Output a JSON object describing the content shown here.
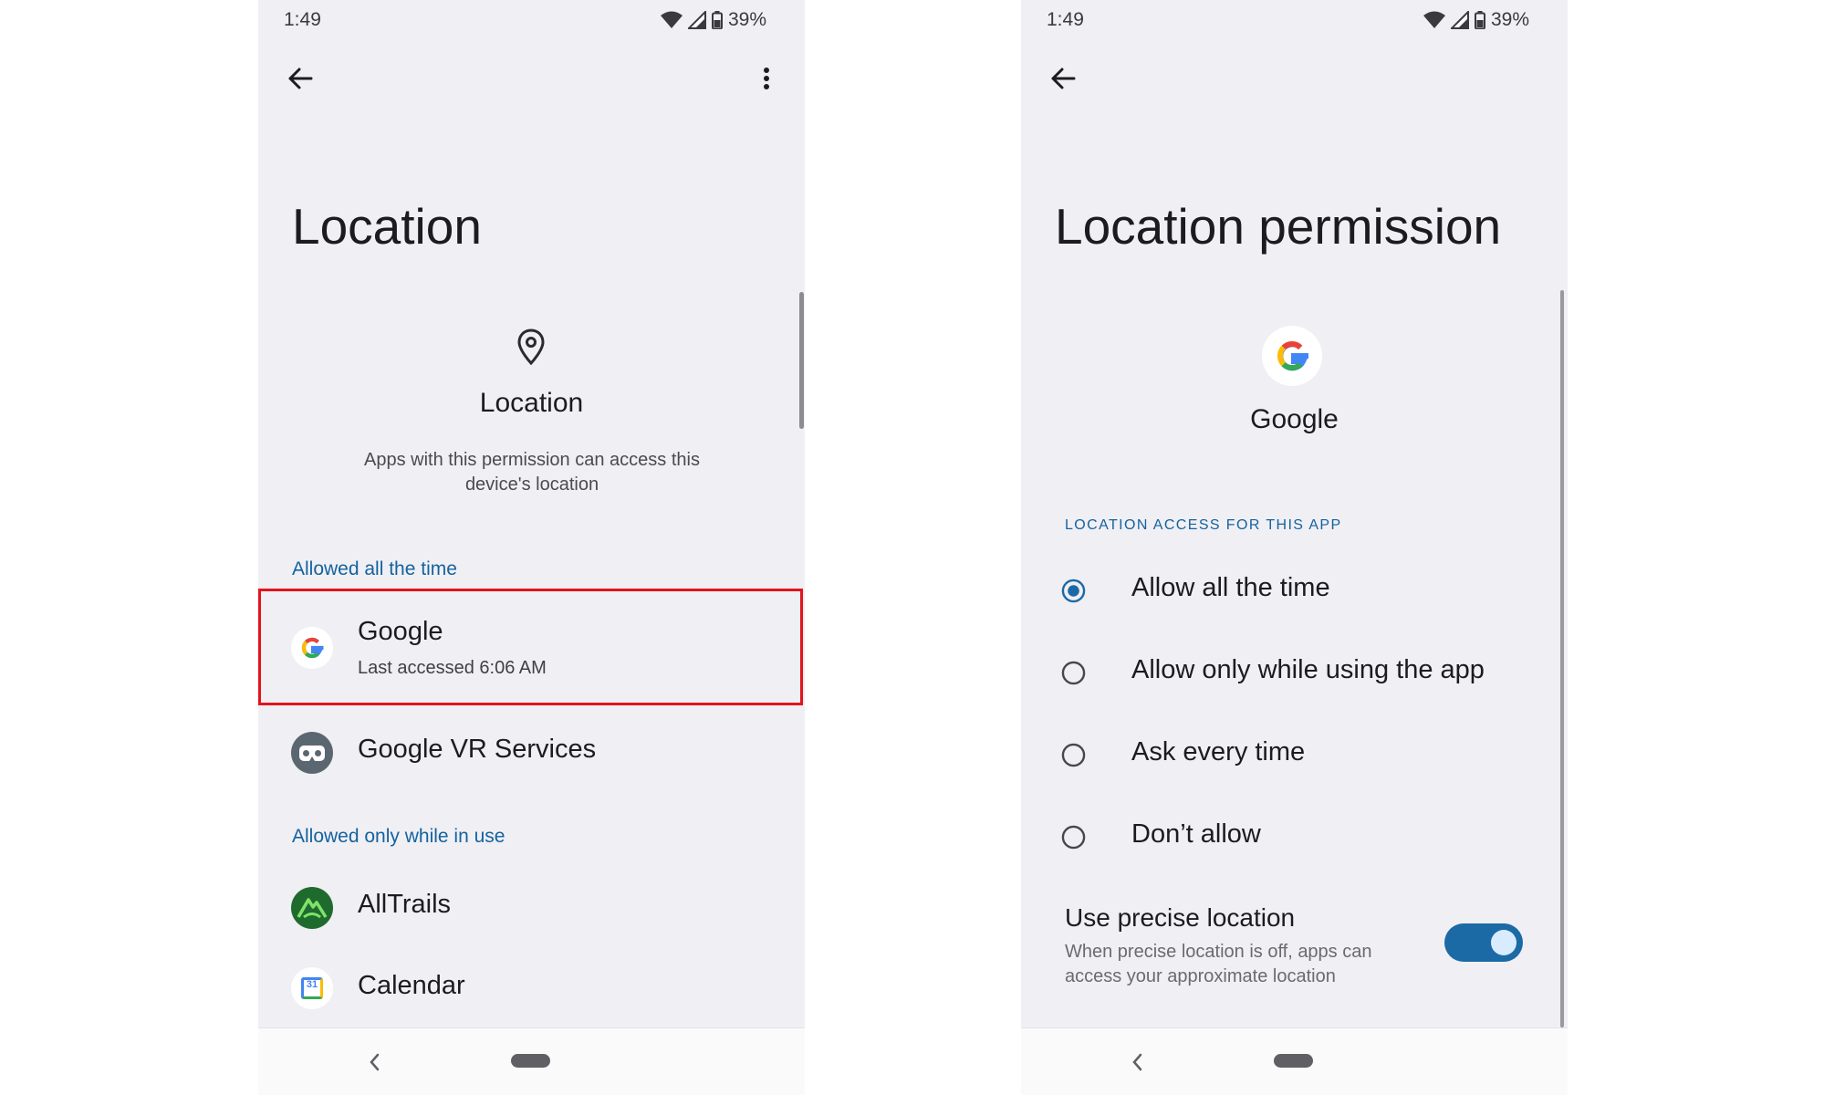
{
  "left": {
    "status": {
      "time": "1:49",
      "battery": "39%"
    },
    "title": "Location",
    "header": {
      "icon": "location-pin-icon",
      "title": "Location",
      "desc": "Apps with this permission can access this device's location"
    },
    "sections": [
      {
        "label": "Allowed all the time",
        "apps": [
          {
            "name": "Google",
            "sub": "Last accessed 6:06 AM",
            "icon": "google-icon",
            "highlighted": true
          },
          {
            "name": "Google VR Services",
            "sub": "",
            "icon": "vr-services-icon"
          }
        ]
      },
      {
        "label": "Allowed only while in use",
        "apps": [
          {
            "name": "AllTrails",
            "sub": "",
            "icon": "alltrails-icon"
          },
          {
            "name": "Calendar",
            "sub": "",
            "icon": "calendar-icon",
            "icon_text": "31"
          }
        ]
      }
    ]
  },
  "right": {
    "status": {
      "time": "1:49",
      "battery": "39%"
    },
    "title": "Location permission",
    "app_name": "Google",
    "section_label": "LOCATION ACCESS FOR THIS APP",
    "options": [
      {
        "label": "Allow all the time",
        "selected": true
      },
      {
        "label": "Allow only while using the app",
        "selected": false
      },
      {
        "label": "Ask every time",
        "selected": false
      },
      {
        "label": "Don’t allow",
        "selected": false
      }
    ],
    "precise": {
      "title": "Use precise location",
      "desc": "When precise location is off, apps can access your approximate location",
      "enabled": true
    }
  },
  "colors": {
    "accent": "#14639e",
    "toggle_on": "#1b6aa5",
    "highlight": "#e3141b",
    "background": "#f0eff4"
  }
}
